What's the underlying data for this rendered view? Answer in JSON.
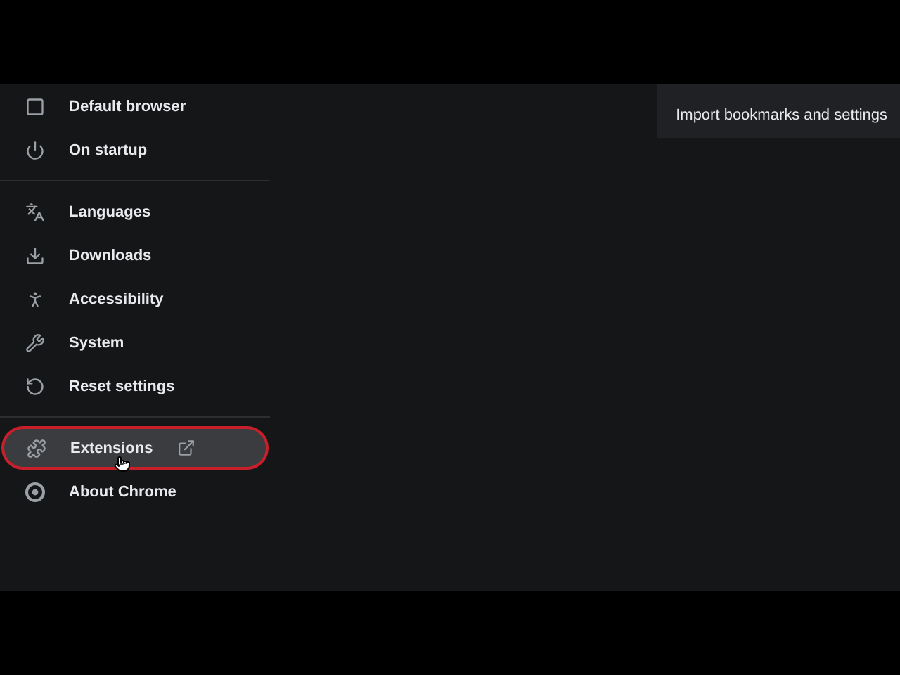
{
  "sidebar": {
    "sections": [
      {
        "items": [
          {
            "label": "Default browser",
            "highlighted": false,
            "external": false
          },
          {
            "label": "On startup",
            "highlighted": false,
            "external": false
          }
        ]
      },
      {
        "items": [
          {
            "label": "Languages",
            "highlighted": false,
            "external": false
          },
          {
            "label": "Downloads",
            "highlighted": false,
            "external": false
          },
          {
            "label": "Accessibility",
            "highlighted": false,
            "external": false
          },
          {
            "label": "System",
            "highlighted": false,
            "external": false
          },
          {
            "label": "Reset settings",
            "highlighted": false,
            "external": false
          }
        ]
      },
      {
        "items": [
          {
            "label": "Extensions",
            "highlighted": true,
            "external": true
          },
          {
            "label": "About Chrome",
            "highlighted": false,
            "external": false
          }
        ]
      }
    ]
  },
  "import_card": {
    "label": "Import bookmarks and settings"
  }
}
